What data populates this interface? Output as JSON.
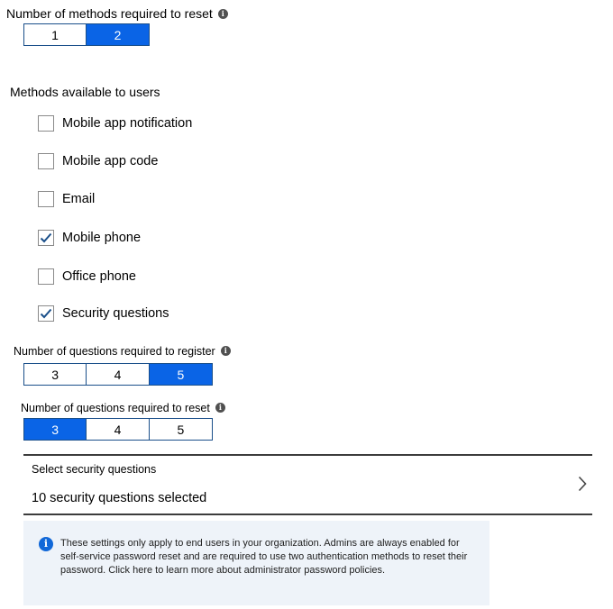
{
  "methods_required": {
    "label": "Number of methods required to reset",
    "options": [
      "1",
      "2"
    ],
    "selected": "2"
  },
  "methods_available": {
    "label": "Methods available to users",
    "items": [
      {
        "label": "Mobile app notification",
        "checked": false
      },
      {
        "label": "Mobile app code",
        "checked": false
      },
      {
        "label": "Email",
        "checked": false
      },
      {
        "label": "Mobile phone",
        "checked": true
      },
      {
        "label": "Office phone",
        "checked": false
      },
      {
        "label": "Security questions",
        "checked": true
      }
    ]
  },
  "questions_register": {
    "label": "Number of questions required to register",
    "options": [
      "3",
      "4",
      "5"
    ],
    "selected": "5"
  },
  "questions_reset": {
    "label": "Number of questions required to reset",
    "options": [
      "3",
      "4",
      "5"
    ],
    "selected": "3"
  },
  "select_questions": {
    "label": "Select security questions",
    "value": "10 security questions selected"
  },
  "info_box": {
    "text": "These settings only apply to end users in your organization. Admins are always enabled for self-service password reset and are required to use two authentication methods to reset their password. Click here to learn more about administrator password policies."
  },
  "colors": {
    "selected_accent": "#0a64e6",
    "segment_border": "#1a4f8a",
    "info_icon": "#1168d8",
    "info_bg": "#eef3f9",
    "checkmark": "#1a4f8a"
  },
  "icons": {
    "info_small": "info-circle-icon",
    "checkmark": "checkmark-icon",
    "chevron": "chevron-right-icon",
    "info_box_icon": "info-icon"
  }
}
